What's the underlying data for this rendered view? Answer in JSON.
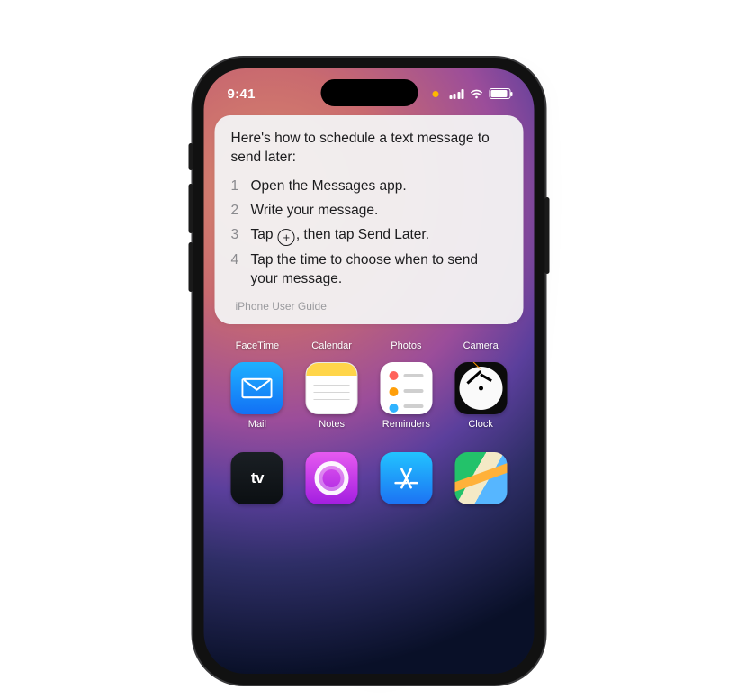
{
  "status": {
    "time": "9:41"
  },
  "card": {
    "heading": "Here's how to schedule a text message to send later:",
    "steps": {
      "s1": "Open the Messages app.",
      "s2": "Write your message.",
      "s3a": "Tap ",
      "s3b": ", then tap Send Later.",
      "s4": "Tap the time to choose when to send your message."
    },
    "source": "iPhone User Guide"
  },
  "apps": {
    "row1": {
      "a": "FaceTime",
      "b": "Calendar",
      "c": "Photos",
      "d": "Camera"
    },
    "row2": {
      "a": "Mail",
      "b": "Notes",
      "c": "Reminders",
      "d": "Clock"
    }
  }
}
